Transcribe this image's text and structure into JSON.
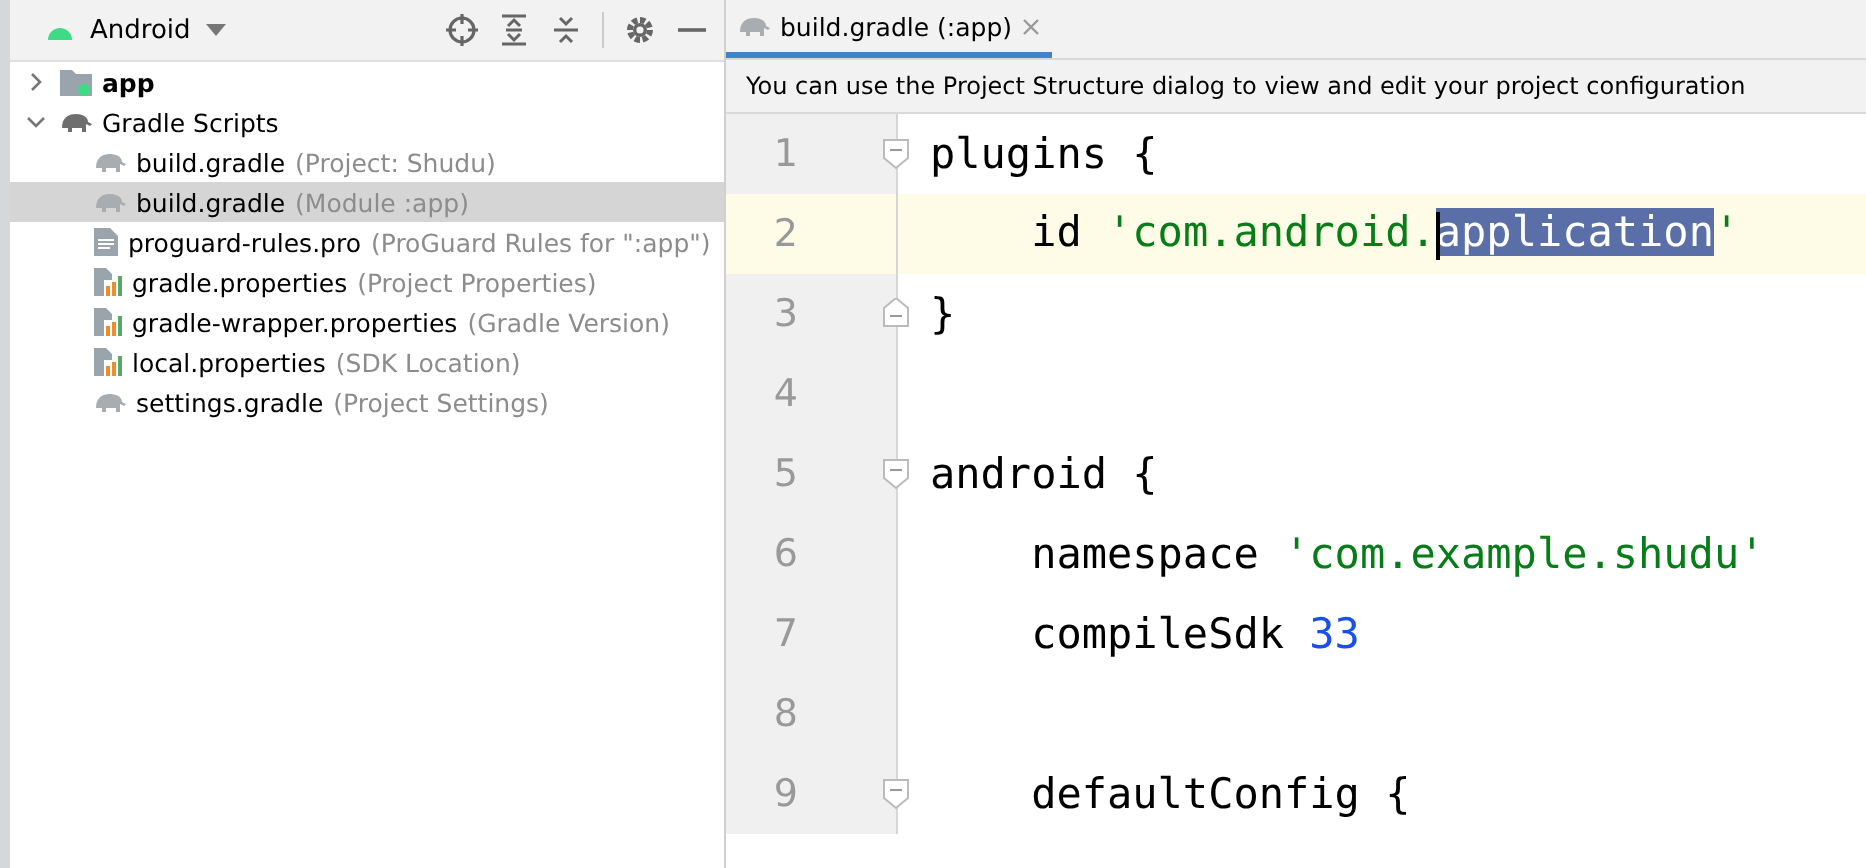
{
  "project_panel": {
    "view": "Android",
    "tree": [
      {
        "label": "app",
        "kind": "module",
        "expanded": false,
        "selected": false
      },
      {
        "label": "Gradle Scripts",
        "kind": "gradle-folder",
        "expanded": true,
        "selected": false,
        "children": [
          {
            "label": "build.gradle",
            "hint": "(Project: Shudu)",
            "kind": "gradle",
            "selected": false
          },
          {
            "label": "build.gradle",
            "hint": "(Module :app)",
            "kind": "gradle",
            "selected": true
          },
          {
            "label": "proguard-rules.pro",
            "hint": "(ProGuard Rules for \":app\")",
            "kind": "text",
            "selected": false
          },
          {
            "label": "gradle.properties",
            "hint": "(Project Properties)",
            "kind": "properties",
            "selected": false
          },
          {
            "label": "gradle-wrapper.properties",
            "hint": "(Gradle Version)",
            "kind": "properties",
            "selected": false
          },
          {
            "label": "local.properties",
            "hint": "(SDK Location)",
            "kind": "properties",
            "selected": false
          },
          {
            "label": "settings.gradle",
            "hint": "(Project Settings)",
            "kind": "gradle",
            "selected": false
          }
        ]
      }
    ]
  },
  "editor": {
    "tabs": [
      {
        "label": "build.gradle (:app)",
        "selected": true
      }
    ],
    "notice": "You can use the Project Structure dialog to view and edit your project configuration",
    "lines": [
      {
        "number": "1",
        "current": false,
        "fold_start": true,
        "tokens": [
          {
            "text": "plugins {",
            "kind": "plain"
          }
        ]
      },
      {
        "number": "2",
        "current": true,
        "tokens": [
          {
            "text": "    id ",
            "kind": "plain"
          },
          {
            "text": "'com.android.",
            "kind": "string"
          },
          {
            "text": "application",
            "kind": "string",
            "selected": true,
            "caret": true
          },
          {
            "text": "'",
            "kind": "string"
          }
        ]
      },
      {
        "number": "3",
        "current": false,
        "fold_end": true,
        "tokens": [
          {
            "text": "}",
            "kind": "plain"
          }
        ]
      },
      {
        "number": "4",
        "current": false
      },
      {
        "number": "5",
        "current": false,
        "fold_start": true,
        "tokens": [
          {
            "text": "android {",
            "kind": "plain"
          }
        ]
      },
      {
        "number": "6",
        "current": false,
        "tokens": [
          {
            "text": "    namespace ",
            "kind": "plain"
          },
          {
            "text": "'com.example.shudu'",
            "kind": "string"
          }
        ]
      },
      {
        "number": "7",
        "current": false,
        "tokens": [
          {
            "text": "    compileSdk ",
            "kind": "plain"
          },
          {
            "text": "33",
            "kind": "number"
          }
        ]
      },
      {
        "number": "8",
        "current": false
      },
      {
        "number": "9",
        "current": false,
        "fold_start": true,
        "tokens": [
          {
            "text": "    defaultConfig {",
            "kind": "plain"
          }
        ]
      }
    ]
  }
}
